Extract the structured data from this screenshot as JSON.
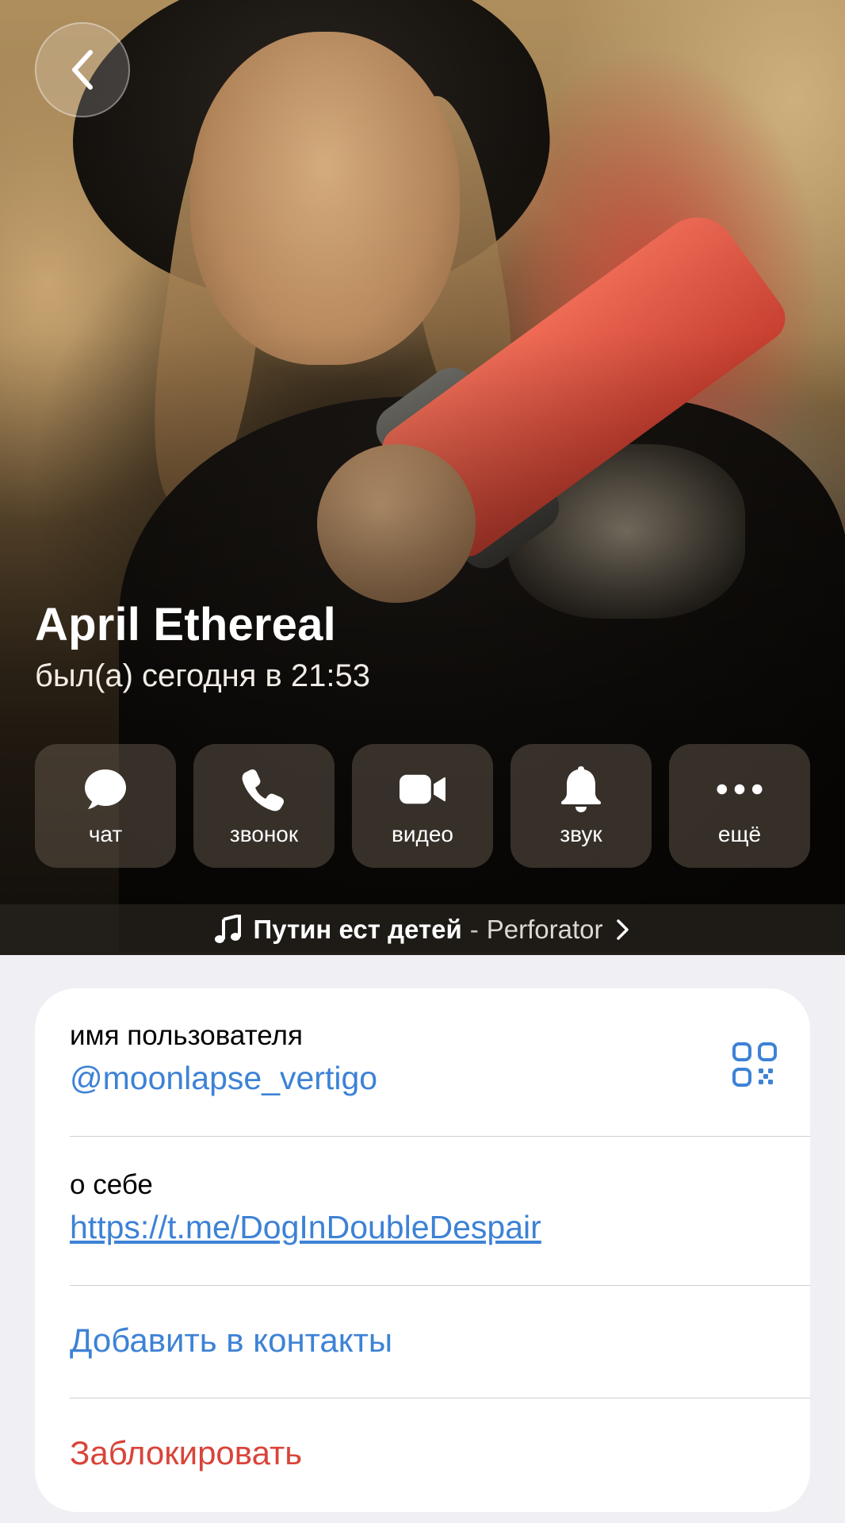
{
  "header": {
    "back_icon": "chevron-left-icon",
    "name": "April Ethereal",
    "status": "был(а) сегодня в 21:53"
  },
  "actions": [
    {
      "label": "чат",
      "icon": "chat-bubble-icon"
    },
    {
      "label": "звонок",
      "icon": "phone-icon"
    },
    {
      "label": "видео",
      "icon": "video-camera-icon"
    },
    {
      "label": "звук",
      "icon": "bell-icon"
    },
    {
      "label": "ещё",
      "icon": "more-dots-icon"
    }
  ],
  "music": {
    "title": "Путин ест детей",
    "separator": "-",
    "artist": "Perforator"
  },
  "info": {
    "username_label": "имя пользователя",
    "username_value": "@moonlapse_vertigo",
    "bio_label": "о себе",
    "bio_value": "https://t.me/DogInDoubleDespair",
    "add_contact": "Добавить в контакты",
    "block": "Заблокировать"
  },
  "colors": {
    "accent": "#3d82d6",
    "danger": "#d9443a",
    "page_background": "#efeff4"
  }
}
